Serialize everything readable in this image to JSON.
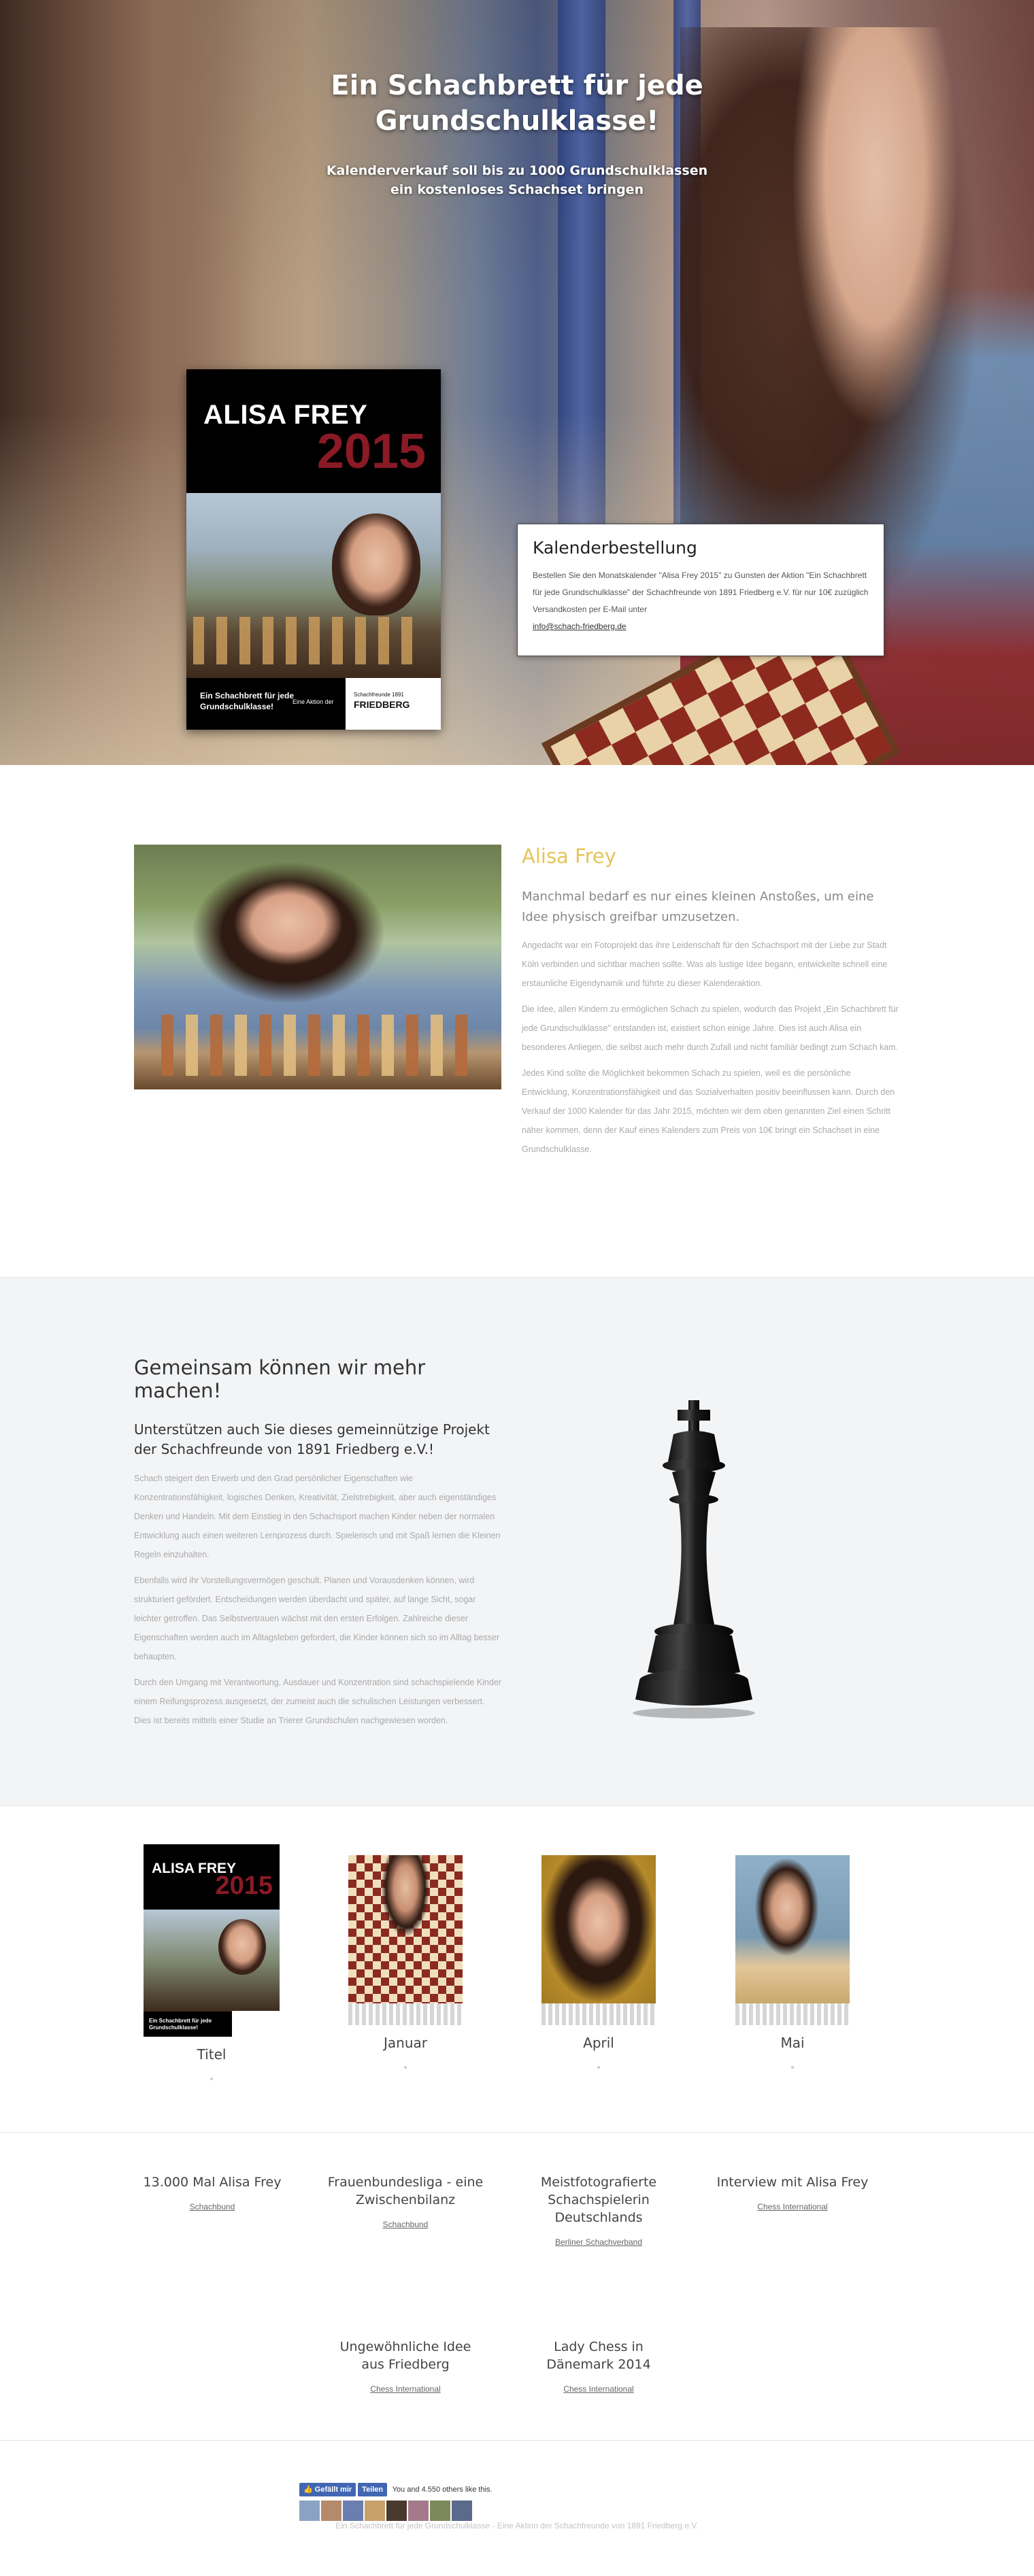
{
  "hero": {
    "title_line1": "Ein Schachbrett für jede",
    "title_line2": "Grundschulklasse!",
    "subtitle_line1": "Kalenderverkauf soll bis zu 1000 Grundschulklassen",
    "subtitle_line2": "ein kostenloses Schachset bringen",
    "cover": {
      "name": "ALISA FREY",
      "year": "2015",
      "footer_text": "Ein Schachbrett für jede Grundschulklasse!",
      "footer_small": "Eine Aktion der",
      "logo_top": "Schachfreunde 1891",
      "logo_main": "FRIEDBERG"
    },
    "order": {
      "title": "Kalenderbestellung",
      "text": "Bestellen Sie den Monatskalender \"Alisa Frey 2015\" zu Gunsten der Aktion \"Ein Schachbrett für jede Grundschulklasse\" der Schachfreunde von 1891 Friedberg e.V. für nur 10€ zuzüglich Versandkosten per E-Mail unter",
      "email": "info@schach-friedberg.de"
    }
  },
  "about": {
    "heading": "Alisa Frey",
    "lead": "Manchmal bedarf es nur eines kleinen Anstoßes, um eine Idee physisch greifbar umzusetzen.",
    "paragraphs": [
      "Angedacht war ein Fotoprojekt das ihre Leidenschaft für den Schachsport mit der Liebe zur Stadt Köln verbinden und sichtbar machen sollte. Was als lustige Idee begann, entwickelte schnell eine erstaunliche Eigendynamik und führte zu dieser Kalenderaktion.",
      "Die Idee, allen Kindern zu ermöglichen Schach zu spielen, wodurch das Projekt „Ein Schachbrett für jede Grundschulklasse\" entstanden ist, existiert schon einige Jahre. Dies ist auch Alisa ein besonderes Anliegen, die selbst auch mehr durch Zufall und nicht familiär bedingt zum Schach kam.",
      "Jedes Kind sollte die Möglichkeit bekommen Schach zu spielen, weil es die persönliche Entwicklung, Konzentrationsfähigkeit und das Sozialverhalten positiv beeinflussen kann. Durch den Verkauf der 1000 Kalender für das Jahr 2015, möchten wir dem oben genannten Ziel einen Schritt näher kommen, denn der Kauf eines Kalenders zum Preis von 10€ bringt ein Schachset in eine Grundschulklasse."
    ]
  },
  "support": {
    "heading": "Gemeinsam können wir mehr machen!",
    "subheading": "Unterstützen auch Sie dieses gemeinnützige Projekt der Schachfreunde von 1891 Friedberg e.V.!",
    "paragraphs": [
      "Schach steigert den Erwerb und den Grad persönlicher Eigenschaften wie Konzentrationsfähigkeit, logisches Denken, Kreativität, Zielstrebigkeit, aber auch eigenständiges Denken und Handeln. Mit dem Einstieg in den Schachsport machen Kinder neben der normalen Entwicklung auch einen weiteren Lernprozess durch. Spielerisch und mit Spaß lernen die Kleinen Regeln einzuhalten.",
      "Ebenfalls wird ihr Vorstellungsvermögen geschult. Planen und Vorausdenken können, wird strukturiert gefördert. Entscheidungen werden überdacht und später, auf lange Sicht, sogar leichter getroffen. Das Selbstvertrauen wächst mit den ersten Erfolgen. Zahlreiche dieser Eigenschaften werden auch im Alltagsleben gefordert, die Kinder können sich so im Alltag besser behaupten.",
      "Durch den Umgang mit Verantwortung, Ausdauer und Konzentration sind schachspielende Kinder einem Reifungsprozess ausgesetzt, der zumeist auch die schulischen Leistungen verbessert. Dies ist bereits mittels einer Studie an Trierer Grundschulen nachgewiesen worden."
    ]
  },
  "months": [
    {
      "label": "Titel"
    },
    {
      "label": "Januar"
    },
    {
      "label": "April"
    },
    {
      "label": "Mai"
    }
  ],
  "months_cover": {
    "name": "ALISA FREY",
    "year": "2015",
    "footer": "Ein Schachbrett für jede Grundschulklasse!"
  },
  "press": [
    {
      "title": "13.000 Mal Alisa Frey",
      "source": "Schachbund"
    },
    {
      "title": "Frauenbundesliga - eine Zwischenbilanz",
      "source": "Schachbund"
    },
    {
      "title": "Meistfotografierte Schachspielerin Deutschlands",
      "source": "Berliner Schachverband"
    },
    {
      "title": "Interview mit Alisa Frey",
      "source": "Chess International"
    },
    {
      "title": "Ungewöhnliche Idee aus Friedberg",
      "source": "Chess International"
    },
    {
      "title": "Lady Chess in Dänemark 2014",
      "source": "Chess International"
    }
  ],
  "footer": {
    "like_label": "Gefällt mir",
    "share_label": "Teilen",
    "like_count": "You and 4.550 others like this.",
    "copyright": "Ein Schachbrett für jede Grundschulklasse - Eine Aktion der Schachfreunde von 1891 Friedberg e.V."
  },
  "colors": {
    "accent": "#e5c55a",
    "cover_year": "#8a1a25",
    "facebook": "#4267b2"
  }
}
